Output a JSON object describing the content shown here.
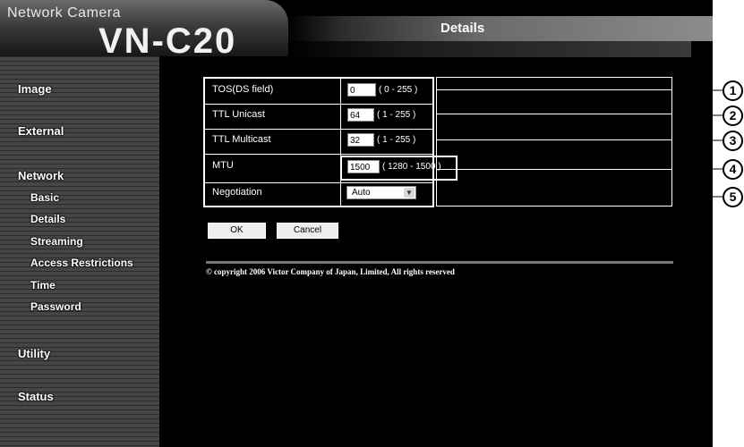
{
  "header": {
    "brand_small": "Network Camera",
    "model": "VN-C20",
    "page_title": "Details"
  },
  "sidebar": {
    "items": [
      {
        "label": "Image"
      },
      {
        "label": "External"
      },
      {
        "label": "Network"
      },
      {
        "label": "Basic"
      },
      {
        "label": "Details"
      },
      {
        "label": "Streaming"
      },
      {
        "label": "Access Restrictions"
      },
      {
        "label": "Time"
      },
      {
        "label": "Password"
      },
      {
        "label": "Utility"
      },
      {
        "label": "Status"
      }
    ]
  },
  "form": {
    "rows": [
      {
        "label": "TOS(DS field)",
        "value": "0",
        "range": "( 0 - 255 )"
      },
      {
        "label": "TTL Unicast",
        "value": "64",
        "range": "( 1 - 255 )"
      },
      {
        "label": "TTL Multicast",
        "value": "32",
        "range": "( 1 - 255 )"
      },
      {
        "label": "MTU",
        "value": "1500",
        "range": "( 1280 - 1500 )"
      },
      {
        "label": "Negotiation",
        "value": "Auto"
      }
    ]
  },
  "buttons": {
    "ok": "OK",
    "cancel": "Cancel"
  },
  "footer": {
    "copyright": "© copyright 2006 Victor Company of Japan, Limited, All rights reserved"
  },
  "callouts": [
    "1",
    "2",
    "3",
    "4",
    "5"
  ]
}
